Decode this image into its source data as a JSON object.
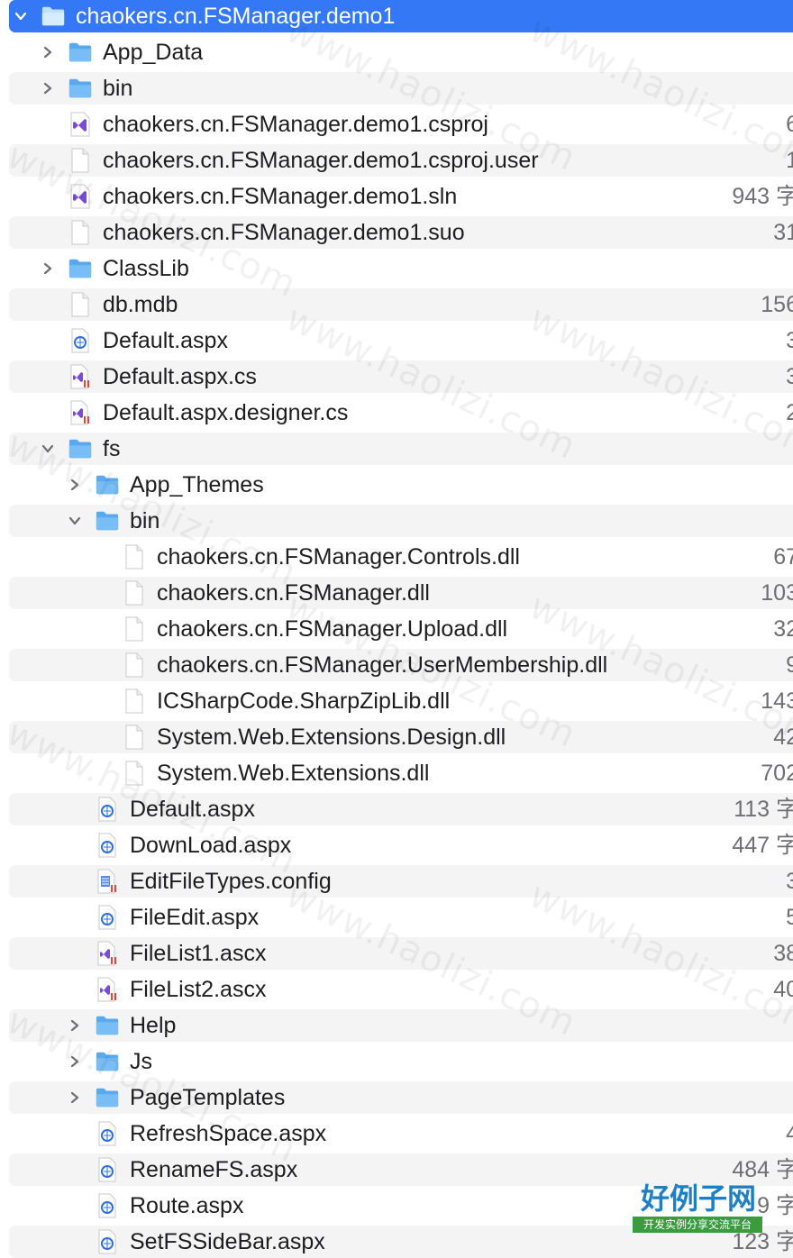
{
  "colors": {
    "selection": "#3478f6",
    "folder": "#5aa8ef",
    "stripe": "#f4f4f5",
    "vs_purple": "#7b4ad9",
    "aspx_blue": "#2f6fd6"
  },
  "tree": [
    {
      "name": "chaokers.cn.FSManager.demo1",
      "kind": "folder",
      "depth": 0,
      "expanded": true,
      "selected": true,
      "size": ""
    },
    {
      "name": "App_Data",
      "kind": "folder",
      "depth": 1,
      "expanded": false,
      "size": ""
    },
    {
      "name": "bin",
      "kind": "folder",
      "depth": 1,
      "expanded": false,
      "size": ""
    },
    {
      "name": "chaokers.cn.FSManager.demo1.csproj",
      "kind": "vs",
      "depth": 1,
      "size": "6"
    },
    {
      "name": "chaokers.cn.FSManager.demo1.csproj.user",
      "kind": "doc",
      "depth": 1,
      "size": "1"
    },
    {
      "name": "chaokers.cn.FSManager.demo1.sln",
      "kind": "vs",
      "depth": 1,
      "size": "943 字"
    },
    {
      "name": "chaokers.cn.FSManager.demo1.suo",
      "kind": "doc",
      "depth": 1,
      "size": "31"
    },
    {
      "name": "ClassLib",
      "kind": "folder",
      "depth": 1,
      "expanded": false,
      "size": ""
    },
    {
      "name": "db.mdb",
      "kind": "doc",
      "depth": 1,
      "size": "156"
    },
    {
      "name": "Default.aspx",
      "kind": "aspx",
      "depth": 1,
      "size": "3"
    },
    {
      "name": "Default.aspx.cs",
      "kind": "cs",
      "depth": 1,
      "size": "3"
    },
    {
      "name": "Default.aspx.designer.cs",
      "kind": "cs",
      "depth": 1,
      "size": "2"
    },
    {
      "name": "fs",
      "kind": "folder",
      "depth": 1,
      "expanded": true,
      "size": ""
    },
    {
      "name": "App_Themes",
      "kind": "folder",
      "depth": 2,
      "expanded": false,
      "size": ""
    },
    {
      "name": "bin",
      "kind": "folder",
      "depth": 2,
      "expanded": true,
      "size": ""
    },
    {
      "name": "chaokers.cn.FSManager.Controls.dll",
      "kind": "doc",
      "depth": 3,
      "size": "67"
    },
    {
      "name": "chaokers.cn.FSManager.dll",
      "kind": "doc",
      "depth": 3,
      "size": "103"
    },
    {
      "name": "chaokers.cn.FSManager.Upload.dll",
      "kind": "doc",
      "depth": 3,
      "size": "32"
    },
    {
      "name": "chaokers.cn.FSManager.UserMembership.dll",
      "kind": "doc",
      "depth": 3,
      "size": "9"
    },
    {
      "name": "ICSharpCode.SharpZipLib.dll",
      "kind": "doc",
      "depth": 3,
      "size": "143"
    },
    {
      "name": "System.Web.Extensions.Design.dll",
      "kind": "doc",
      "depth": 3,
      "size": "42"
    },
    {
      "name": "System.Web.Extensions.dll",
      "kind": "doc",
      "depth": 3,
      "size": "702"
    },
    {
      "name": "Default.aspx",
      "kind": "aspx",
      "depth": 2,
      "size": "113 字"
    },
    {
      "name": "DownLoad.aspx",
      "kind": "aspx",
      "depth": 2,
      "size": "447 字"
    },
    {
      "name": "EditFileTypes.config",
      "kind": "config",
      "depth": 2,
      "size": "3"
    },
    {
      "name": "FileEdit.aspx",
      "kind": "aspx",
      "depth": 2,
      "size": "5"
    },
    {
      "name": "FileList1.ascx",
      "kind": "cs",
      "depth": 2,
      "size": "38"
    },
    {
      "name": "FileList2.ascx",
      "kind": "cs",
      "depth": 2,
      "size": "40"
    },
    {
      "name": "Help",
      "kind": "folder",
      "depth": 2,
      "expanded": false,
      "size": ""
    },
    {
      "name": "Js",
      "kind": "folder",
      "depth": 2,
      "expanded": false,
      "size": ""
    },
    {
      "name": "PageTemplates",
      "kind": "folder",
      "depth": 2,
      "expanded": false,
      "size": ""
    },
    {
      "name": "RefreshSpace.aspx",
      "kind": "aspx",
      "depth": 2,
      "size": "4"
    },
    {
      "name": "RenameFS.aspx",
      "kind": "aspx",
      "depth": 2,
      "size": "484 字"
    },
    {
      "name": "Route.aspx",
      "kind": "aspx",
      "depth": 2,
      "size": "9 字"
    },
    {
      "name": "SetFSSideBar.aspx",
      "kind": "aspx",
      "depth": 2,
      "size": "123 字"
    }
  ],
  "watermark_text": "www.haolizi.com",
  "brand": {
    "title": "好例子网",
    "subtitle": "开发实例分享交流平台"
  }
}
